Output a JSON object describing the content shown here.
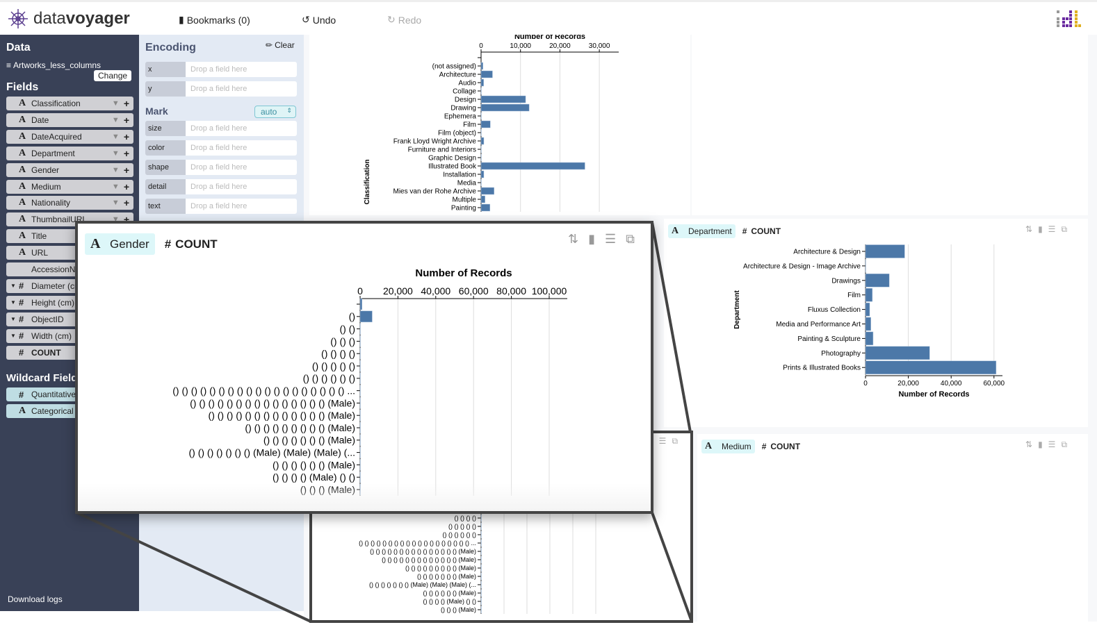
{
  "app": {
    "logo_light": "data",
    "logo_bold": "voyager",
    "bookmarks": "Bookmarks (0)",
    "undo": "Undo",
    "redo": "Redo"
  },
  "sidebar": {
    "data_title": "Data",
    "dataset": "Artworks_less_columns",
    "change": "Change",
    "fields_title": "Fields",
    "fields": [
      {
        "type": "A",
        "name": "Classification"
      },
      {
        "type": "A",
        "name": "Date"
      },
      {
        "type": "A",
        "name": "DateAcquired"
      },
      {
        "type": "A",
        "name": "Department"
      },
      {
        "type": "A",
        "name": "Gender"
      },
      {
        "type": "A",
        "name": "Medium"
      },
      {
        "type": "A",
        "name": "Nationality"
      },
      {
        "type": "A",
        "name": "ThumbnailURL"
      },
      {
        "type": "A",
        "name": "Title"
      },
      {
        "type": "A",
        "name": "URL"
      },
      {
        "type": "",
        "name": "AccessionNumber"
      },
      {
        "type": "#",
        "name": "Diameter (cm)"
      },
      {
        "type": "#",
        "name": "Height (cm)"
      },
      {
        "type": "#",
        "name": "ObjectID"
      },
      {
        "type": "#",
        "name": "Width (cm)"
      },
      {
        "type": "#",
        "name": "COUNT"
      }
    ],
    "wildcard_title": "Wildcard Fields",
    "wildcards": [
      {
        "type": "#",
        "name": "Quantitative"
      },
      {
        "type": "A",
        "name": "Categorical"
      }
    ],
    "download_logs": "Download logs"
  },
  "encoding": {
    "title": "Encoding",
    "clear": "Clear",
    "mark_title": "Mark",
    "mark_value": "auto",
    "placeholder": "Drop a field here",
    "channels": [
      "x",
      "y",
      "size",
      "color",
      "shape",
      "detail",
      "text"
    ]
  },
  "cards": {
    "department": {
      "field_type": "A",
      "field": "Department",
      "count_type": "#",
      "count": "COUNT"
    },
    "gender": {
      "field_type": "A",
      "field": "Gender",
      "count_type": "#",
      "count": "COUNT"
    },
    "medium": {
      "field_type": "A",
      "field": "Medium",
      "count_type": "#",
      "count": "COUNT"
    }
  },
  "colors": {
    "bar": "#4c78a8",
    "sidebar": "#394157",
    "encoding_bg": "#e3eaf4",
    "chip": "#ddf7f9"
  },
  "chart_data": [
    {
      "id": "classification",
      "type": "bar",
      "orientation": "horizontal",
      "xlabel": "Number of Records",
      "ylabel": "Classification",
      "x_ticks": [
        "0",
        "10,000",
        "20,000",
        "30,000"
      ],
      "x_tick_values": [
        0,
        10000,
        20000,
        30000
      ],
      "grid": true,
      "categories": [
        "",
        "(not assigned)",
        "Architecture",
        "Audio",
        "Collage",
        "Design",
        "Drawing",
        "Ephemera",
        "Film",
        "Film (object)",
        "Frank Lloyd Wright Archive",
        "Furniture and Interiors",
        "Graphic Design",
        "Illustrated Book",
        "Installation",
        "Media",
        "Mies van der Rohe Archive",
        "Multiple",
        "Painting"
      ],
      "values": [
        0,
        470,
        2900,
        650,
        30,
        11300,
        12200,
        30,
        2350,
        30,
        700,
        30,
        30,
        26350,
        700,
        30,
        3300,
        1000,
        2250
      ]
    },
    {
      "id": "department",
      "type": "bar",
      "orientation": "horizontal",
      "xlabel": "Number of Records",
      "ylabel": "Department",
      "x_ticks": [
        "0",
        "20,000",
        "40,000",
        "60,000"
      ],
      "x_tick_values": [
        0,
        20000,
        40000,
        60000
      ],
      "grid": true,
      "categories": [
        "Architecture & Design",
        "Architecture & Design - Image Archive",
        "Drawings",
        "Film",
        "Fluxus Collection",
        "Media and Performance Art",
        "Painting & Sculpture",
        "Photography",
        "Prints & Illustrated Books"
      ],
      "values": [
        18300,
        30,
        11100,
        3200,
        1950,
        2500,
        3550,
        29950,
        61000
      ]
    },
    {
      "id": "gender",
      "type": "bar",
      "orientation": "horizontal",
      "xlabel": "Number of Records",
      "ylabel": "",
      "x_ticks": [
        "0",
        "20,000",
        "40,000",
        "60,000",
        "80,000",
        "100,000"
      ],
      "x_tick_values": [
        0,
        20000,
        40000,
        60000,
        80000,
        100000
      ],
      "grid": true,
      "categories": [
        "",
        "()",
        "() ()",
        "() () ()",
        "() () () ()",
        "() () () () ()",
        "() () () () () ()",
        "() () () () () () () () () () () () () () () () () () () ...",
        "() () () () () () () () () () () () () () () (Male)",
        "() () () () () () () () () () () () () (Male)",
        "() () () () () () () () () (Male)",
        "() () () () () () () (Male)",
        "() () () () () () () (Male) (Male) (Male) (...",
        "() () () () () () (Male)",
        "() () () () (Male) () ()",
        "() () () (Male)"
      ],
      "values": [
        1000,
        6400,
        30,
        30,
        30,
        30,
        30,
        30,
        30,
        30,
        30,
        30,
        30,
        30,
        30,
        30
      ]
    }
  ]
}
